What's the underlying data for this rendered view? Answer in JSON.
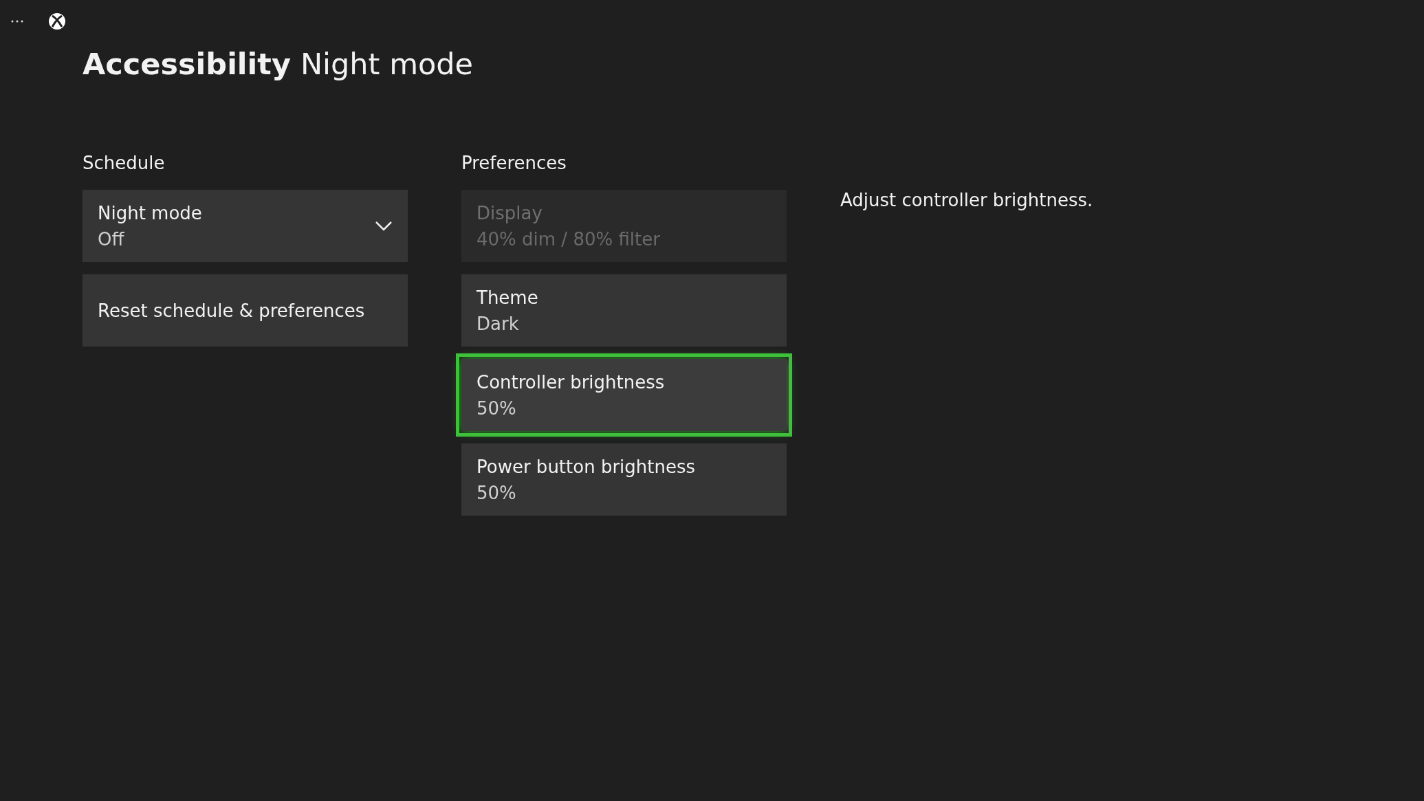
{
  "header": {
    "section": "Accessibility",
    "page": "Night mode"
  },
  "schedule": {
    "heading": "Schedule",
    "items": [
      {
        "kind": "dropdown",
        "label": "Night mode",
        "value": "Off",
        "selected": false
      },
      {
        "kind": "button",
        "label": "Reset schedule & preferences",
        "selected": false
      }
    ]
  },
  "preferences": {
    "heading": "Preferences",
    "items": [
      {
        "label": "Display",
        "value": "40% dim / 80% filter",
        "disabled": true,
        "selected": false
      },
      {
        "label": "Theme",
        "value": "Dark",
        "disabled": false,
        "selected": false
      },
      {
        "label": "Controller brightness",
        "value": "50%",
        "disabled": false,
        "selected": true
      },
      {
        "label": "Power button brightness",
        "value": "50%",
        "disabled": false,
        "selected": false
      }
    ]
  },
  "description": "Adjust controller brightness."
}
